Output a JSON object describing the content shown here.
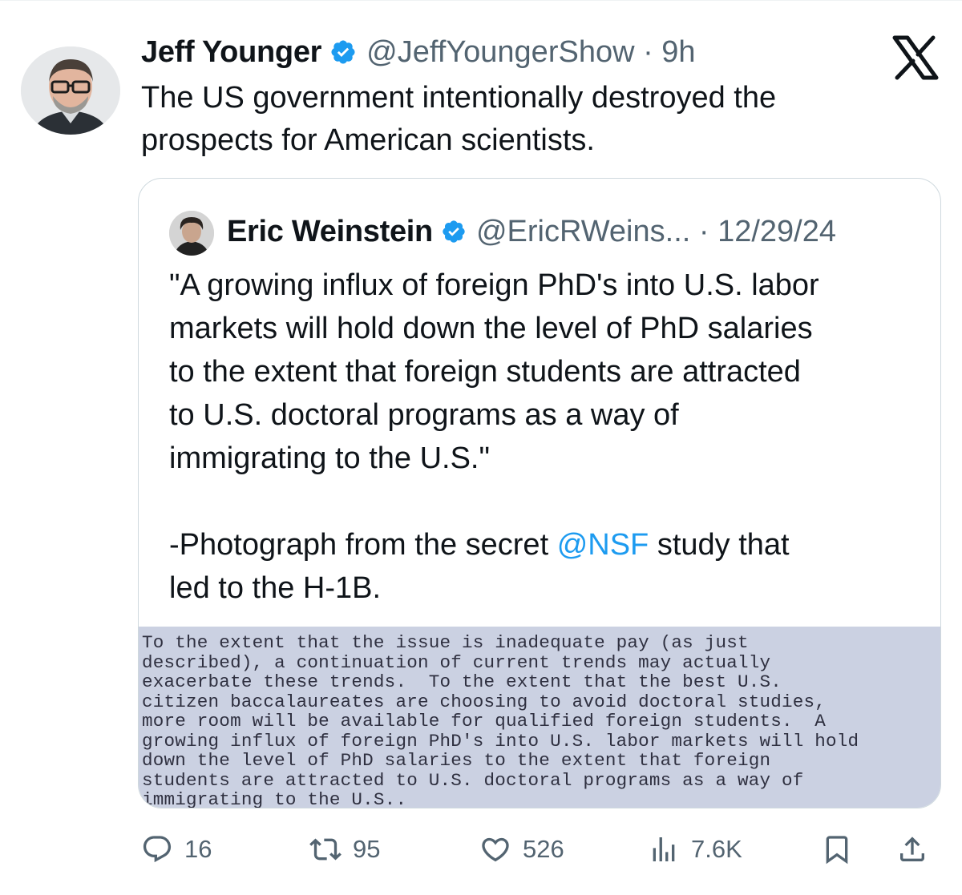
{
  "tweet": {
    "author_name": "Jeff Younger",
    "handle_time": "@JeffYoungerShow · 9h",
    "text": "The US government intentionally destroyed the\nprospects for American scientists."
  },
  "quoted_tweet": {
    "author_name": "Eric Weinstein",
    "handle_time": "@EricRWeins... · 12/29/24",
    "text_quote": "\"A growing influx of foreign PhD's into U.S. labor\nmarkets will hold down the level of PhD salaries\nto the extent that foreign students are attracted\nto U.S. doctoral programs as a way of\nimmigrating to the U.S.\"",
    "text_prefix": "-Photograph from the secret ",
    "mention": "@NSF",
    "text_suffix": " study that\nled to the H-1B.",
    "document_lines": [
      "To the extent that the issue is inadequate pay (as just",
      "described), a continuation of current trends may actually",
      "exacerbate these trends.  To the extent that the best U.S.",
      "citizen baccalaureates are choosing to avoid doctoral studies,",
      "more room will be available for qualified foreign students.  A",
      "growing influx of foreign PhD's into U.S. labor markets will hold",
      "down the level of PhD salaries to the extent that foreign",
      "students are attracted to U.S. doctoral programs as a way of",
      "immigrating to the U.S.."
    ]
  },
  "actions": {
    "replies": "16",
    "reposts": "95",
    "likes": "526",
    "views": "7.6K"
  },
  "colors": {
    "verified_badge": "#1d9bf0",
    "mention": "#1d9bf0",
    "secondary_text": "#536471",
    "document_background": "#cbd1e2"
  },
  "icons": [
    "x-logo-icon",
    "verified-badge-icon",
    "reply-icon",
    "repost-icon",
    "like-icon",
    "views-icon",
    "bookmark-icon",
    "share-icon"
  ]
}
